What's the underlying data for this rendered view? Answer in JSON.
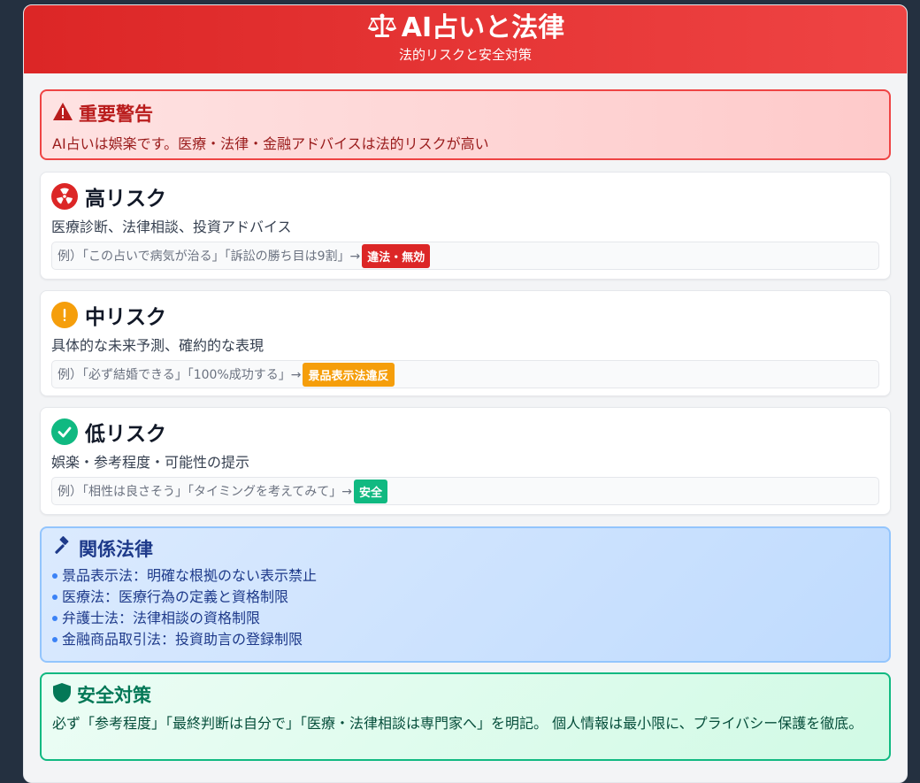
{
  "header": {
    "title": "AI占いと法律",
    "subtitle": "法的リスクと安全対策"
  },
  "warning": {
    "title": "重要警告",
    "text": "AI占いは娯楽です。医療・法律・金融アドバイスは法的リスクが高い",
    "icon": "warning-icon"
  },
  "risks": [
    {
      "title": "高リスク",
      "desc": "医療診断、法律相談、投資アドバイス",
      "example": "例）「この占いで病気が治る」「訴訟の勝ち目は9割」→",
      "badge": "違法・無効",
      "color": "#dc2626",
      "icon": "radiation-icon"
    },
    {
      "title": "中リスク",
      "desc": "具体的な未来予測、確約的な表現",
      "example": "例）「必ず結婚できる」「100%成功する」→",
      "badge": "景品表示法違反",
      "color": "#f59e0b",
      "icon": "exclamation-icon"
    },
    {
      "title": "低リスク",
      "desc": "娯楽・参考程度・可能性の提示",
      "example": "例）「相性は良さそう」「タイミングを考えてみて」→",
      "badge": "安全",
      "color": "#10b981",
      "icon": "check-icon"
    }
  ],
  "laws": {
    "title": "関係法律",
    "icon": "gavel-icon",
    "items": [
      "景品表示法：明確な根拠のない表示禁止",
      "医療法：医療行為の定義と資格制限",
      "弁護士法：法律相談の資格制限",
      "金融商品取引法：投資助言の登録制限"
    ]
  },
  "safety": {
    "title": "安全対策",
    "icon": "shield-icon",
    "text": "必ず「参考程度」「最終判断は自分で」「医療・法律相談は専門家へ」を明記。 個人情報は最小限に、プライバシー保護を徹底。"
  }
}
